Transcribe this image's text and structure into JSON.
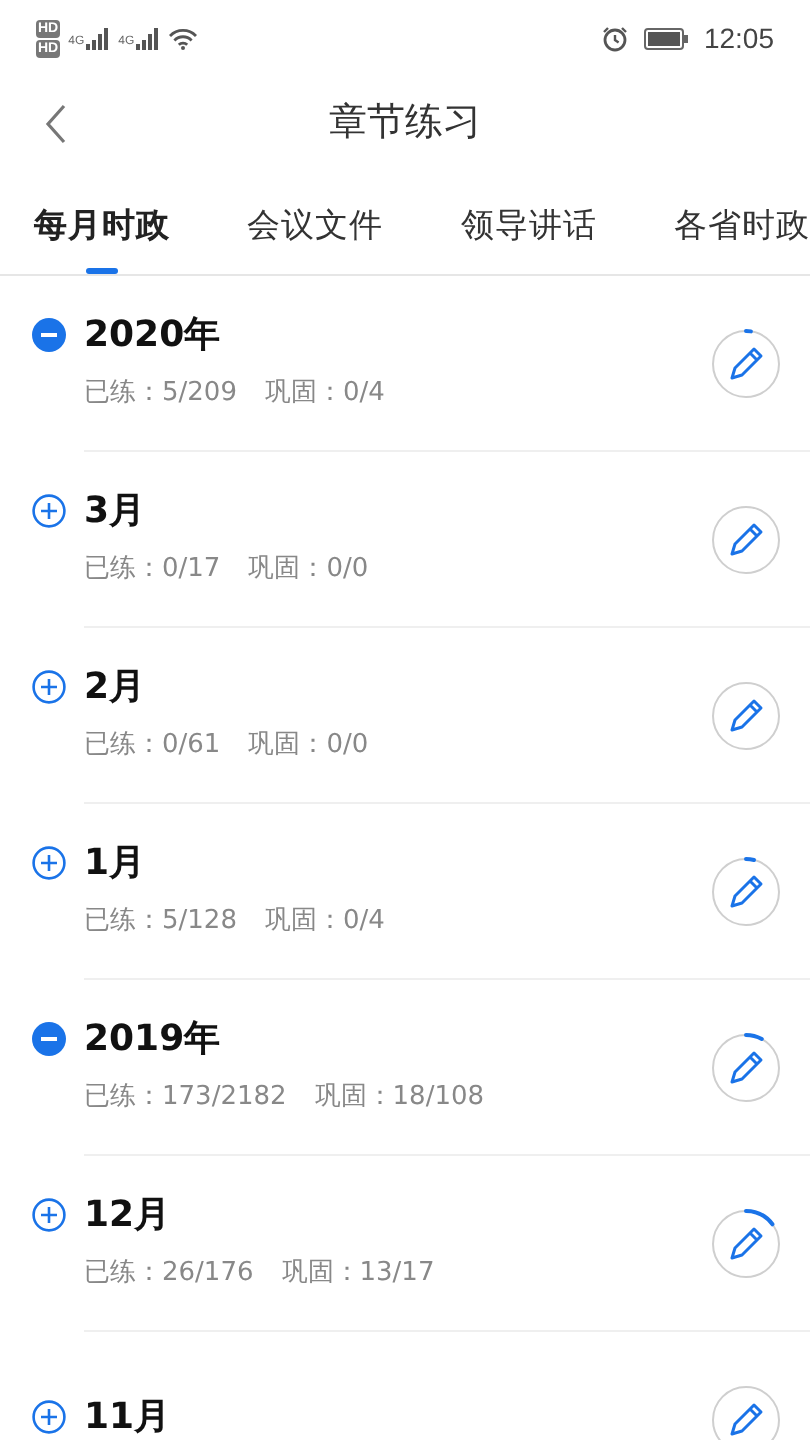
{
  "status_bar": {
    "hd_labels": [
      "HD",
      "HD"
    ],
    "network_labels": [
      "4G",
      "4G"
    ],
    "time": "12:05"
  },
  "header": {
    "title": "章节练习"
  },
  "tabs": [
    {
      "label": "每月时政",
      "selected": true
    },
    {
      "label": "会议文件",
      "selected": false
    },
    {
      "label": "领导讲话",
      "selected": false
    },
    {
      "label": "各省时政",
      "selected": false
    }
  ],
  "chapters": [
    {
      "title": "2020年",
      "expanded": true,
      "practiced": "已练：5/209",
      "review": "巩固：0/4"
    },
    {
      "title": "3月",
      "expanded": false,
      "practiced": "已练：0/17",
      "review": "巩固：0/0"
    },
    {
      "title": "2月",
      "expanded": false,
      "practiced": "已练：0/61",
      "review": "巩固：0/0"
    },
    {
      "title": "1月",
      "expanded": false,
      "practiced": "已练：5/128",
      "review": "巩固：0/4"
    },
    {
      "title": "2019年",
      "expanded": true,
      "practiced": "已练：173/2182",
      "review": "巩固：18/108"
    },
    {
      "title": "12月",
      "expanded": false,
      "practiced": "已练：26/176",
      "review": "巩固：13/17"
    },
    {
      "title": "11月",
      "expanded": false
    }
  ]
}
